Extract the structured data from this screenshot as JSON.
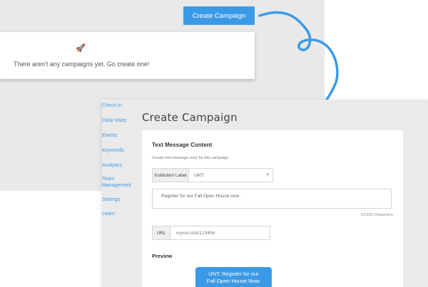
{
  "top": {
    "create_button": "Create Campaign",
    "empty_state": {
      "icon": "rocket-icon",
      "message": "There aren't any campaigns yet. Go create one!"
    }
  },
  "sidebar": {
    "items": [
      {
        "label": "Check In"
      },
      {
        "label": "Daily Visits"
      },
      {
        "label": "Events"
      },
      {
        "label": "Keywords"
      },
      {
        "label": "Analytics"
      },
      {
        "label": "Team"
      },
      {
        "label": "Management"
      },
      {
        "label": "Settings"
      },
      {
        "label": "Learn"
      }
    ]
  },
  "form": {
    "page_title": "Create Campaign",
    "section_title": "Text Message Content",
    "helper": "Create text message copy for this campaign.",
    "institution_label": "Institution Label",
    "institution_value": "UNT:",
    "message": "Register for our Fall Open House now:",
    "char_count": "61/160 Characters",
    "url_label": "URL",
    "url_value": "myvst.co/k/123456",
    "preview_title": "Preview",
    "preview_line1": "UNT: Register for our",
    "preview_line2": "Fall Open House Now:"
  },
  "colors": {
    "accent": "#3b9ae6",
    "panel": "#eaeaea"
  }
}
